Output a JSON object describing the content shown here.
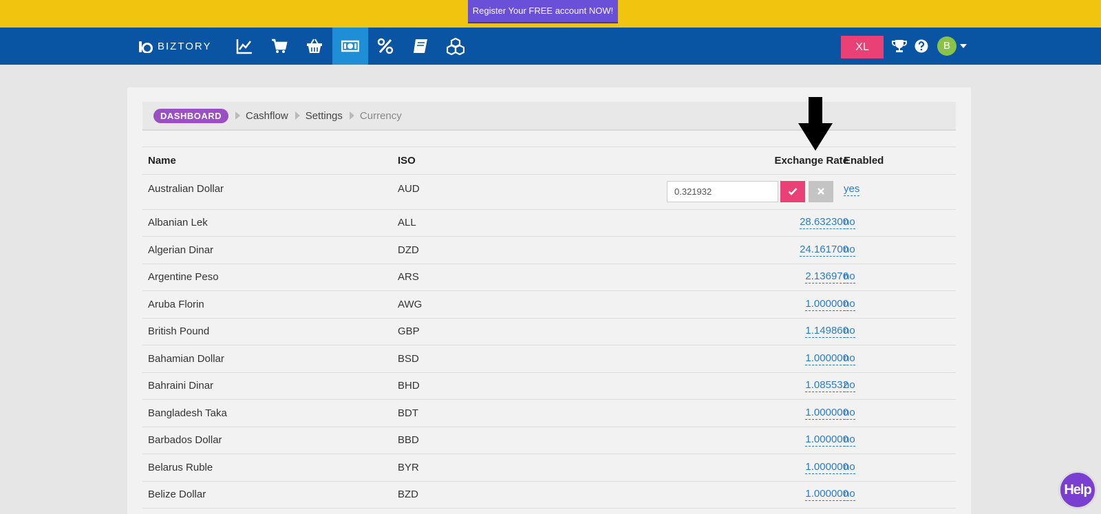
{
  "promo": {
    "label": "Register Your FREE account NOW!"
  },
  "navbar": {
    "brand": "BIZTORY",
    "icons": [
      "chart-line-icon",
      "cart-icon",
      "basket-icon",
      "money-icon",
      "percent-icon",
      "book-icon",
      "cubes-icon"
    ],
    "active_index": 3,
    "plan_badge": "XL",
    "avatar_initial": "B"
  },
  "breadcrumb": {
    "dashboard": "DASHBOARD",
    "items": [
      "Cashflow",
      "Settings",
      "Currency"
    ]
  },
  "table": {
    "headers": {
      "name": "Name",
      "iso": "ISO",
      "rate": "Exchange Rate",
      "enabled": "Enabled"
    },
    "editing_row": {
      "name": "Australian Dollar",
      "iso": "AUD",
      "rate_value": "0.321932",
      "enabled": "yes"
    },
    "rows": [
      {
        "name": "Albanian Lek",
        "iso": "ALL",
        "rate": "28.632300",
        "enabled": "no"
      },
      {
        "name": "Algerian Dinar",
        "iso": "DZD",
        "rate": "24.161700",
        "enabled": "no"
      },
      {
        "name": "Argentine Peso",
        "iso": "ARS",
        "rate": "2.136976",
        "enabled": "no"
      },
      {
        "name": "Aruba Florin",
        "iso": "AWG",
        "rate": "1.000000",
        "enabled": "no"
      },
      {
        "name": "British Pound",
        "iso": "GBP",
        "rate": "1.149860",
        "enabled": "no"
      },
      {
        "name": "Bahamian Dollar",
        "iso": "BSD",
        "rate": "1.000000",
        "enabled": "no"
      },
      {
        "name": "Bahraini Dinar",
        "iso": "BHD",
        "rate": "1.085532",
        "enabled": "no"
      },
      {
        "name": "Bangladesh Taka",
        "iso": "BDT",
        "rate": "1.000000",
        "enabled": "no"
      },
      {
        "name": "Barbados Dollar",
        "iso": "BBD",
        "rate": "1.000000",
        "enabled": "no"
      },
      {
        "name": "Belarus Ruble",
        "iso": "BYR",
        "rate": "1.000000",
        "enabled": "no"
      },
      {
        "name": "Belize Dollar",
        "iso": "BZD",
        "rate": "1.000000",
        "enabled": "no"
      }
    ]
  },
  "help": {
    "label": "Help"
  },
  "colors": {
    "promo": "#f1c40f",
    "navbar": "#0a55a3",
    "accent": "#e94075",
    "dashboard_pill": "#9b4fc4",
    "link": "#2a7cc7"
  }
}
